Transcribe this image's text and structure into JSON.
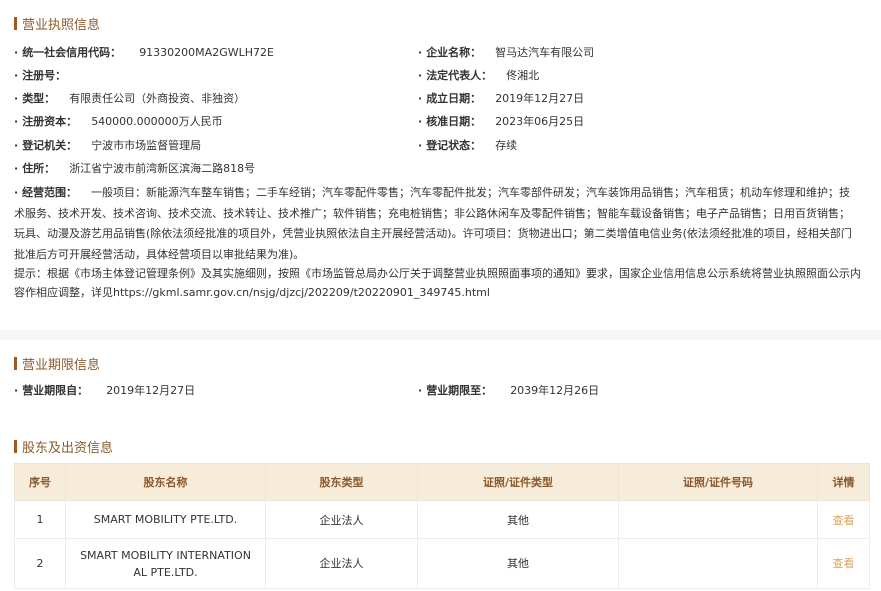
{
  "license_section": {
    "title": "营业执照信息",
    "credit_code": {
      "label": "统一社会信用代码：",
      "value": "91330200MA2GWLH72E"
    },
    "company_name": {
      "label": "企业名称：",
      "value": "智马达汽车有限公司"
    },
    "reg_no": {
      "label": "注册号：",
      "value": ""
    },
    "legal_rep": {
      "label": "法定代表人：",
      "value": "佟湘北"
    },
    "type": {
      "label": "类型：",
      "value": "有限责任公司（外商投资、非独资）"
    },
    "est_date": {
      "label": "成立日期：",
      "value": "2019年12月27日"
    },
    "capital": {
      "label": "注册资本：",
      "value": "540000.000000万人民币"
    },
    "approve_date": {
      "label": "核准日期：",
      "value": "2023年06月25日"
    },
    "authority": {
      "label": "登记机关：",
      "value": "宁波市市场监督管理局"
    },
    "status": {
      "label": "登记状态：",
      "value": "存续"
    },
    "address": {
      "label": "住所：",
      "value": "浙江省宁波市前湾新区滨海二路818号"
    },
    "scope": {
      "label": "经营范围：",
      "value": "一般项目：新能源汽车整车销售；二手车经销；汽车零配件零售；汽车零配件批发；汽车零部件研发；汽车装饰用品销售；汽车租赁；机动车修理和维护；技术服务、技术开发、技术咨询、技术交流、技术转让、技术推广；软件销售；充电桩销售；非公路休闲车及零配件销售；智能车载设备销售；电子产品销售；日用百货销售；玩具、动漫及游艺用品销售(除依法须经批准的项目外，凭营业执照依法自主开展经营活动)。许可项目：货物进出口；第二类增值电信业务(依法须经批准的项目，经相关部门批准后方可开展经营活动，具体经营项目以审批结果为准)。"
    },
    "notice": "提示：根据《市场主体登记管理条例》及其实施细则，按照《市场监管总局办公厅关于调整营业执照照面事项的通知》要求，国家企业信用信息公示系统将营业执照照面公示内容作相应调整，详见https://gkml.samr.gov.cn/nsjg/djzcj/202209/t20220901_349745.html"
  },
  "term_section": {
    "title": "营业期限信息",
    "from": {
      "label": "营业期限自：",
      "value": "2019年12月27日"
    },
    "to": {
      "label": "营业期限至：",
      "value": "2039年12月26日"
    }
  },
  "shareholder_section": {
    "title": "股东及出资信息",
    "headers": [
      "序号",
      "股东名称",
      "股东类型",
      "证照/证件类型",
      "证照/证件号码",
      "详情"
    ],
    "rows": [
      {
        "no": "1",
        "name": "SMART MOBILITY PTE.LTD.",
        "type": "企业法人",
        "cert_type": "其他",
        "cert_no": "",
        "detail": "查看"
      },
      {
        "no": "2",
        "name_line1": "SMART MOBILITY INTERNATION",
        "name_line2": "AL PTE.LTD.",
        "type": "企业法人",
        "cert_type": "其他",
        "cert_no": "",
        "detail": "查看"
      }
    ]
  }
}
